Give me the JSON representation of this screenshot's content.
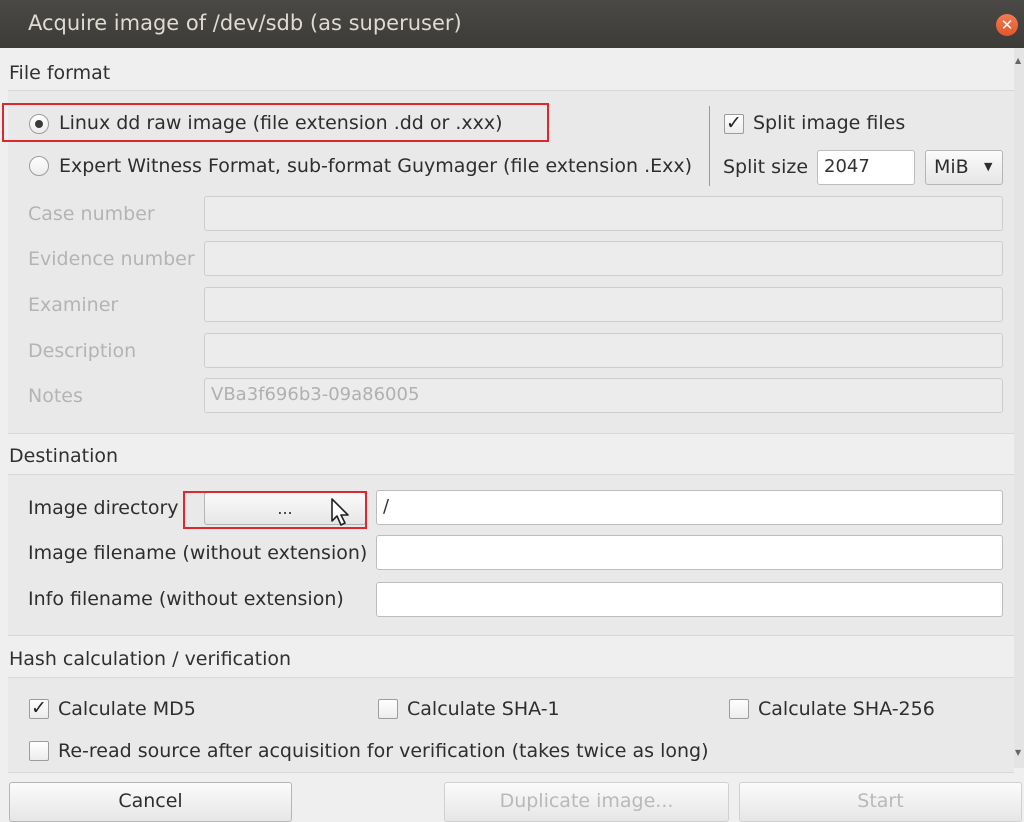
{
  "window": {
    "title": "Acquire image of /dev/sdb (as superuser)",
    "close_icon": "close-icon"
  },
  "file_format": {
    "title": "File format",
    "radio_dd_label": "Linux dd raw image (file extension .dd or .xxx)",
    "radio_ewf_label": "Expert Witness Format, sub-format Guymager (file extension .Exx)",
    "radio_dd_selected": true,
    "split_checkbox_label": "Split image files",
    "split_checked": true,
    "split_size_label": "Split size",
    "split_size_value": "2047",
    "split_unit": "MiB",
    "case_number_label": "Case number",
    "case_number_value": "",
    "evidence_number_label": "Evidence number",
    "evidence_number_value": "",
    "examiner_label": "Examiner",
    "examiner_value": "",
    "description_label": "Description",
    "description_value": "",
    "notes_label": "Notes",
    "notes_value": "VBa3f696b3-09a86005"
  },
  "destination": {
    "title": "Destination",
    "image_directory_label": "Image directory",
    "browse_button_label": "...",
    "image_directory_value": "/",
    "image_filename_label": "Image filename (without extension)",
    "image_filename_value": "",
    "info_filename_label": "Info filename (without extension)",
    "info_filename_value": ""
  },
  "hash": {
    "title": "Hash calculation / verification",
    "md5_label": "Calculate MD5",
    "md5_checked": true,
    "sha1_label": "Calculate SHA-1",
    "sha256_label": "Calculate SHA-256",
    "reread_label": "Re-read source after acquisition for verification (takes twice as long)"
  },
  "buttons": {
    "cancel": "Cancel",
    "duplicate": "Duplicate image...",
    "start": "Start"
  },
  "colors": {
    "highlight": "#e0262e",
    "titlebar": "#3c3b37",
    "close": "#e2562a"
  }
}
